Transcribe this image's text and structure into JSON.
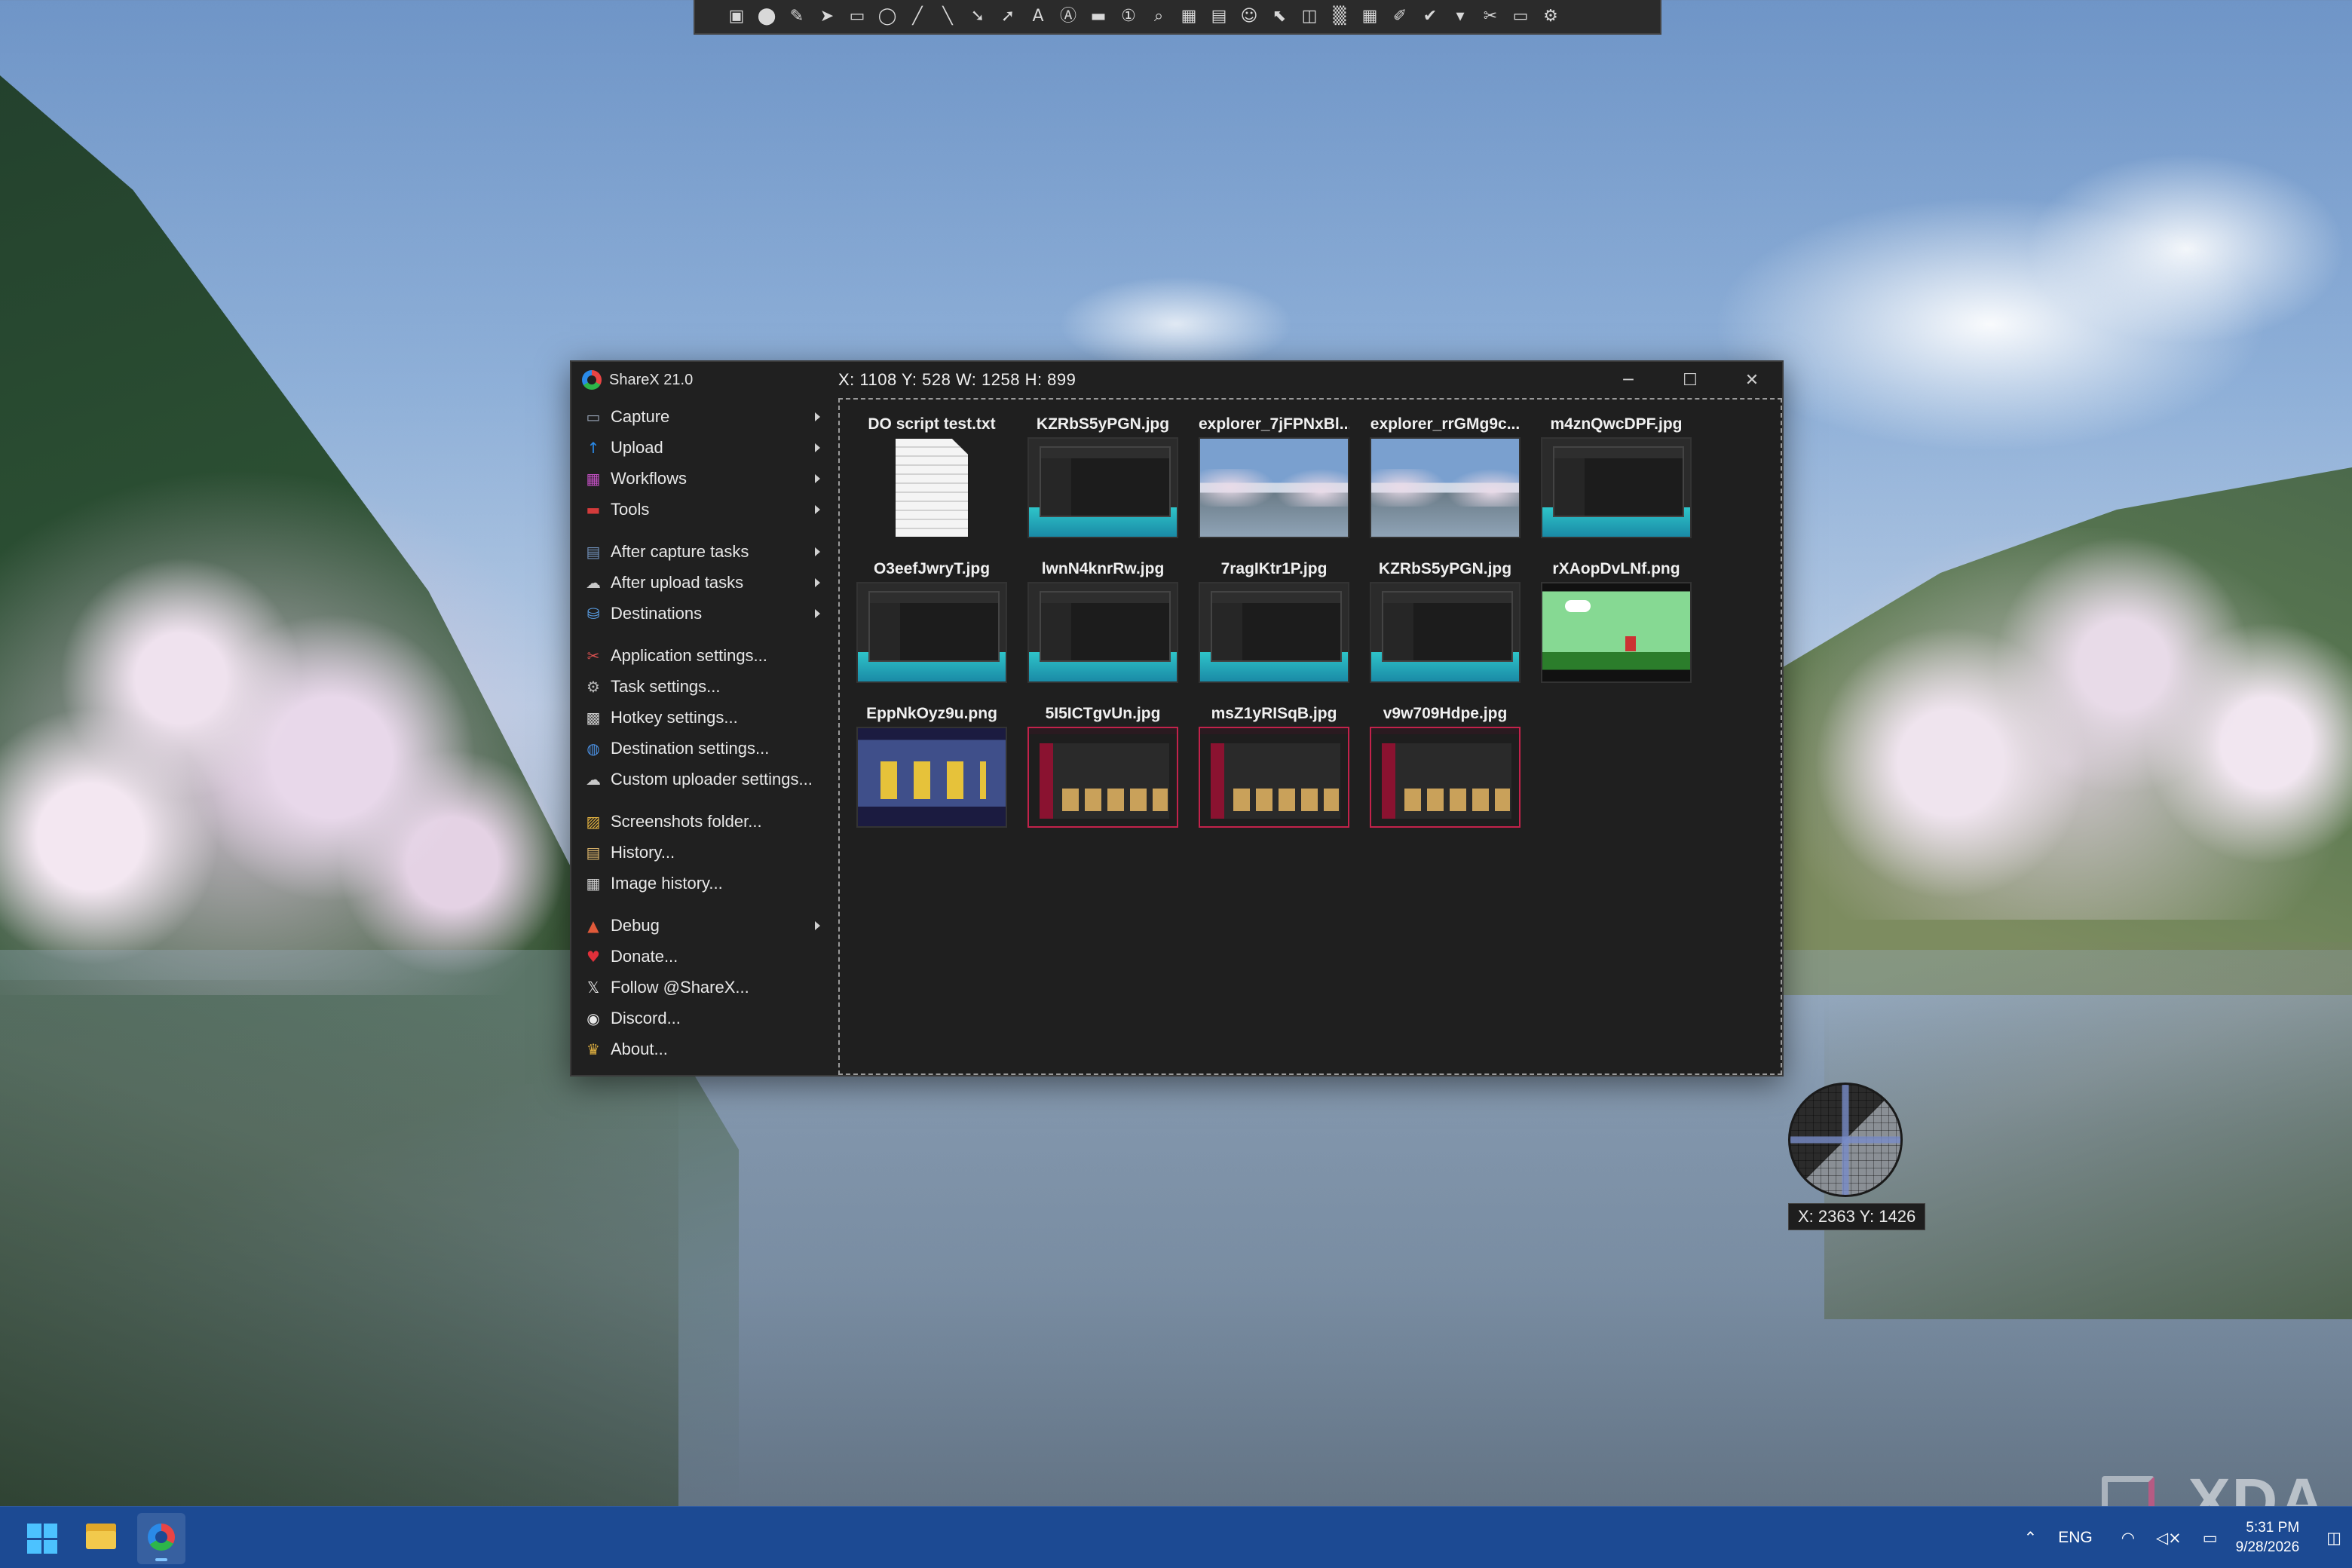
{
  "toolbar": {
    "icons": [
      "region-icon",
      "ellipse-icon",
      "freehand-icon",
      "select-icon",
      "rectangle-icon",
      "ellipse-shape-icon",
      "pen-icon",
      "line-icon",
      "arrow-icon",
      "arrow-icon-2",
      "text-outline-icon",
      "text-background-icon",
      "speech-balloon-icon",
      "step-icon",
      "magnify-icon",
      "image-icon",
      "sticker-icon",
      "emoji-icon",
      "cursor-icon",
      "eraser-icon",
      "blur-icon",
      "pixelate-icon",
      "highlight-icon",
      "crop-icon",
      "more-options-icon",
      "tools-icon",
      "edit-icon",
      "settings-icon"
    ],
    "glyphs": [
      "▣",
      "⬤",
      "✎",
      "➤",
      "▭",
      "◯",
      "╱",
      "╲",
      "➘",
      "➚",
      "A",
      "Ⓐ",
      "▬",
      "①",
      "⌕",
      "▦",
      "▤",
      "☺",
      "⬉",
      "◫",
      "▒",
      "▦",
      "✐",
      "✔",
      "▾",
      "✂",
      "▭",
      "⚙"
    ]
  },
  "window": {
    "title": "ShareX 21.0",
    "coords": "X: 1108 Y: 528 W: 1258 H: 899",
    "min_glyph": "─",
    "max_glyph": "☐",
    "close_glyph": "✕"
  },
  "menu": {
    "items": [
      {
        "label": "Capture",
        "icon": "capture-icon",
        "glyph": "▭",
        "color": "#9aa6b8",
        "submenu": true
      },
      {
        "label": "Upload",
        "icon": "upload-icon",
        "glyph": "↑",
        "color": "#2a8ae8",
        "submenu": true
      },
      {
        "label": "Workflows",
        "icon": "workflows-icon",
        "glyph": "▦",
        "color": "#c04fc0",
        "submenu": true
      },
      {
        "label": "Tools",
        "icon": "tools-icon",
        "glyph": "▬",
        "color": "#d33b3b",
        "submenu": true
      },
      {
        "label": "After capture tasks",
        "icon": "after-capture-icon",
        "glyph": "▤",
        "color": "#6f8fb8",
        "submenu": true
      },
      {
        "label": "After upload tasks",
        "icon": "after-upload-icon",
        "glyph": "☁",
        "color": "#c8c8c8",
        "submenu": true
      },
      {
        "label": "Destinations",
        "icon": "destinations-icon",
        "glyph": "⛁",
        "color": "#5aa0e8",
        "submenu": true
      },
      {
        "label": "Application settings...",
        "icon": "app-settings-icon",
        "glyph": "✂",
        "color": "#d85050",
        "submenu": false
      },
      {
        "label": "Task settings...",
        "icon": "task-settings-icon",
        "glyph": "⚙",
        "color": "#b8b8b8",
        "submenu": false
      },
      {
        "label": "Hotkey settings...",
        "icon": "hotkey-settings-icon",
        "glyph": "▩",
        "color": "#c8c8c8",
        "submenu": false
      },
      {
        "label": "Destination settings...",
        "icon": "destination-settings-icon",
        "glyph": "◍",
        "color": "#4a8fe0",
        "submenu": false
      },
      {
        "label": "Custom uploader settings...",
        "icon": "custom-uploader-icon",
        "glyph": "☁",
        "color": "#c8c8c8",
        "submenu": false
      },
      {
        "label": "Screenshots folder...",
        "icon": "folder-icon",
        "glyph": "▨",
        "color": "#e0b040",
        "submenu": false
      },
      {
        "label": "History...",
        "icon": "history-icon",
        "glyph": "▤",
        "color": "#d9b36a",
        "submenu": false
      },
      {
        "label": "Image history...",
        "icon": "image-history-icon",
        "glyph": "▦",
        "color": "#c8c8c8",
        "submenu": false
      },
      {
        "label": "Debug",
        "icon": "debug-icon",
        "glyph": "▲",
        "color": "#e05a3a",
        "submenu": true
      },
      {
        "label": "Donate...",
        "icon": "heart-icon",
        "glyph": "♥",
        "color": "#e0303a",
        "submenu": false
      },
      {
        "label": "Follow @ShareX...",
        "icon": "x-logo-icon",
        "glyph": "𝕏",
        "color": "#e8e8e8",
        "submenu": false
      },
      {
        "label": "Discord...",
        "icon": "discord-icon",
        "glyph": "◉",
        "color": "#e8e8e8",
        "submenu": false
      },
      {
        "label": "About...",
        "icon": "crown-icon",
        "glyph": "♛",
        "color": "#e0b040",
        "submenu": false
      }
    ]
  },
  "thumbnails": [
    {
      "name": "DO script test.txt",
      "kind": "doc"
    },
    {
      "name": "KZRbS5yPGN.jpg",
      "kind": "app"
    },
    {
      "name": "explorer_7jFPNxBl...",
      "kind": "lake"
    },
    {
      "name": "explorer_rrGMg9c...",
      "kind": "lake"
    },
    {
      "name": "m4znQwcDPF.jpg",
      "kind": "app"
    },
    {
      "name": "O3eefJwryT.jpg",
      "kind": "app"
    },
    {
      "name": "lwnN4knrRw.jpg",
      "kind": "app"
    },
    {
      "name": "7ragIKtr1P.jpg",
      "kind": "app"
    },
    {
      "name": "KZRbS5yPGN.jpg",
      "kind": "app"
    },
    {
      "name": "rXAopDvLNf.png",
      "kind": "game"
    },
    {
      "name": "EppNkOyz9u.png",
      "kind": "car"
    },
    {
      "name": "5I5ICTgvUn.jpg",
      "kind": "web"
    },
    {
      "name": "msZ1yRISqB.jpg",
      "kind": "web"
    },
    {
      "name": "v9w709Hdpe.jpg",
      "kind": "web"
    }
  ],
  "magnifier": {
    "coords": "X: 2363 Y: 1426"
  },
  "taskbar": {
    "language": "ENG",
    "time": "5:31 PM",
    "date": "9/28/2026",
    "tray_glyphs": {
      "chevron": "⌃",
      "wifi": "◠",
      "volume": "◁×",
      "battery": "▭",
      "notification": "◫"
    }
  },
  "watermark": "XDA"
}
